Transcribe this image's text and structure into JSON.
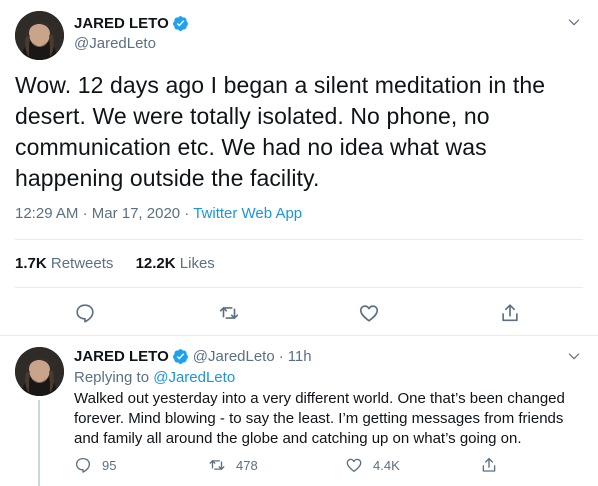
{
  "main_tweet": {
    "author_name": "JARED LETO",
    "author_handle": "@JaredLeto",
    "text": "Wow. 12 days ago I began a silent meditation in the desert. We were totally isolated. No phone, no communication etc. We had no idea what was happening outside the facility.",
    "time": "12:29 AM",
    "date": "Mar 17, 2020",
    "separator": "·",
    "source": "Twitter Web App",
    "retweets_count": "1.7K",
    "retweets_label": "Retweets",
    "likes_count": "12.2K",
    "likes_label": "Likes"
  },
  "reply_tweet": {
    "author_name": "JARED LETO",
    "author_handle": "@JaredLeto",
    "separator": "·",
    "age": "11h",
    "replying_prefix": "Replying to",
    "replying_to": "@JaredLeto",
    "text": "Walked out yesterday into a very different world. One that’s been changed forever. Mind blowing - to say the least. I’m getting messages from friends and family all around the globe and catching up on what’s going on.",
    "reply_count": "95",
    "retweet_count": "478",
    "like_count": "4.4K"
  },
  "icons": {
    "verified": "verified-badge-icon",
    "chevron": "chevron-down-icon",
    "reply": "reply-bubble-icon",
    "retweet": "retweet-arrows-icon",
    "like": "heart-icon",
    "share": "share-upload-icon"
  },
  "colors": {
    "accent": "#1b95e0",
    "verified": "#1da1f2",
    "secondary_text": "#5b7083",
    "divider": "#e6ecf0"
  }
}
